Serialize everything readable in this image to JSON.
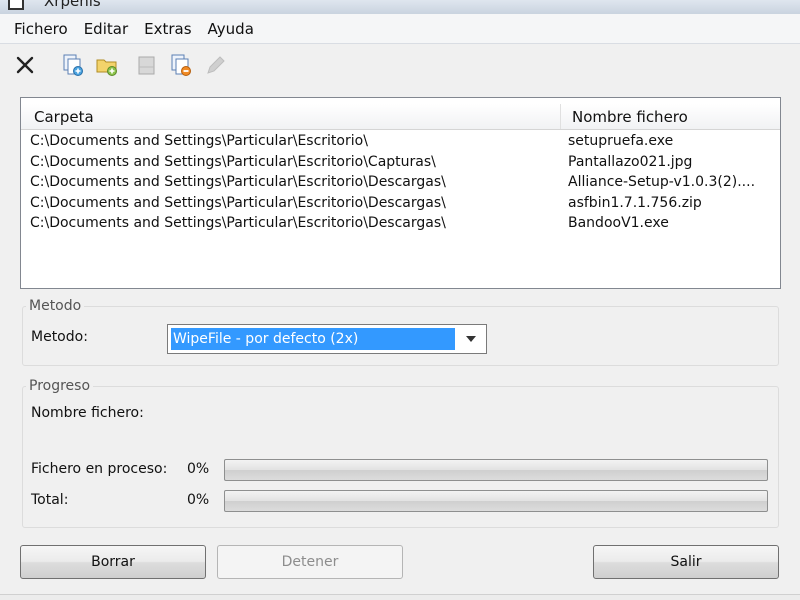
{
  "window": {
    "title": "Xrpenis"
  },
  "menu": [
    "Fichero",
    "Editar",
    "Extras",
    "Ayuda"
  ],
  "toolbar": {
    "icons": [
      "delete-icon",
      "add-files-icon",
      "add-folder-icon",
      "clear-list-icon",
      "remove-files-icon",
      "edit-icon"
    ]
  },
  "files": {
    "columns": [
      "Carpeta",
      "Nombre fichero"
    ],
    "rows": [
      {
        "folder": "C:\\Documents and Settings\\Particular\\Escritorio\\",
        "name": "setupruefa.exe"
      },
      {
        "folder": "C:\\Documents and Settings\\Particular\\Escritorio\\Capturas\\",
        "name": "Pantallazo021.jpg"
      },
      {
        "folder": "C:\\Documents and Settings\\Particular\\Escritorio\\Descargas\\",
        "name": "Alliance-Setup-v1.0.3(2)...."
      },
      {
        "folder": "C:\\Documents and Settings\\Particular\\Escritorio\\Descargas\\",
        "name": "asfbin1.7.1.756.zip"
      },
      {
        "folder": "C:\\Documents and Settings\\Particular\\Escritorio\\Descargas\\",
        "name": "BandooV1.exe"
      }
    ]
  },
  "method": {
    "group_title": "Metodo",
    "label": "Metodo:",
    "selected": "WipeFile - por defecto (2x)"
  },
  "progress": {
    "group_title": "Progreso",
    "file_label": "Nombre fichero:",
    "current_label": "Fichero en proceso:",
    "current_text": "0%",
    "current_value": 0,
    "total_label": "Total:",
    "total_text": "0%",
    "total_value": 0
  },
  "buttons": {
    "delete": "Borrar",
    "stop": "Detener",
    "exit": "Salir"
  },
  "colors": {
    "selection": "#3399ff",
    "progress_fill": "#2bc23d"
  }
}
